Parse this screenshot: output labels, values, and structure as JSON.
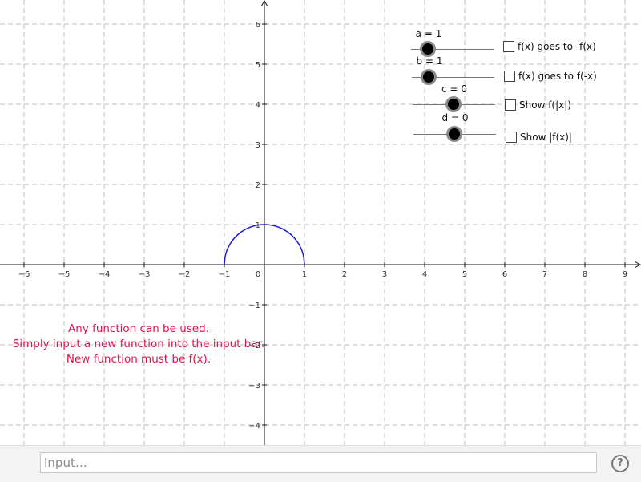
{
  "graph": {
    "x_range": [
      -6.6,
      9.35
    ],
    "y_range": [
      -4.5,
      6.5
    ],
    "x_ticks": [
      "−6",
      "−5",
      "−4",
      "−3",
      "−2",
      "−1",
      "0",
      "1",
      "2",
      "3",
      "4",
      "5",
      "6",
      "7",
      "8",
      "9"
    ],
    "y_ticks": [
      "−4",
      "−3",
      "−2",
      "−1",
      "1",
      "2",
      "3",
      "4",
      "5",
      "6"
    ],
    "curve": {
      "function": "semicircle",
      "domain": [
        -1,
        1
      ],
      "color": "#1a1acc"
    },
    "axis_color": "#111111",
    "grid_color": "#bfbfbf"
  },
  "sliders": [
    {
      "name": "a",
      "label": "a = 1",
      "value": 1
    },
    {
      "name": "b",
      "label": "b = 1",
      "value": 1
    },
    {
      "name": "c",
      "label": "c = 0",
      "value": 0
    },
    {
      "name": "d",
      "label": "d = 0",
      "value": 0
    }
  ],
  "checkboxes": [
    {
      "label": "f(x) goes to -f(x)",
      "checked": false
    },
    {
      "label": "f(x) goes to f(-x)",
      "checked": false
    },
    {
      "label": "Show f(|x|)",
      "checked": false
    },
    {
      "label": "Show |f(x)|",
      "checked": false
    }
  ],
  "note": {
    "line1": "Any function can be used.",
    "line2": "Simply input a new function into the input bar.",
    "line3": "New function must be f(x).",
    "color": "#e0134b"
  },
  "input_bar": {
    "placeholder": "Input…"
  },
  "help": {
    "glyph": "?"
  }
}
